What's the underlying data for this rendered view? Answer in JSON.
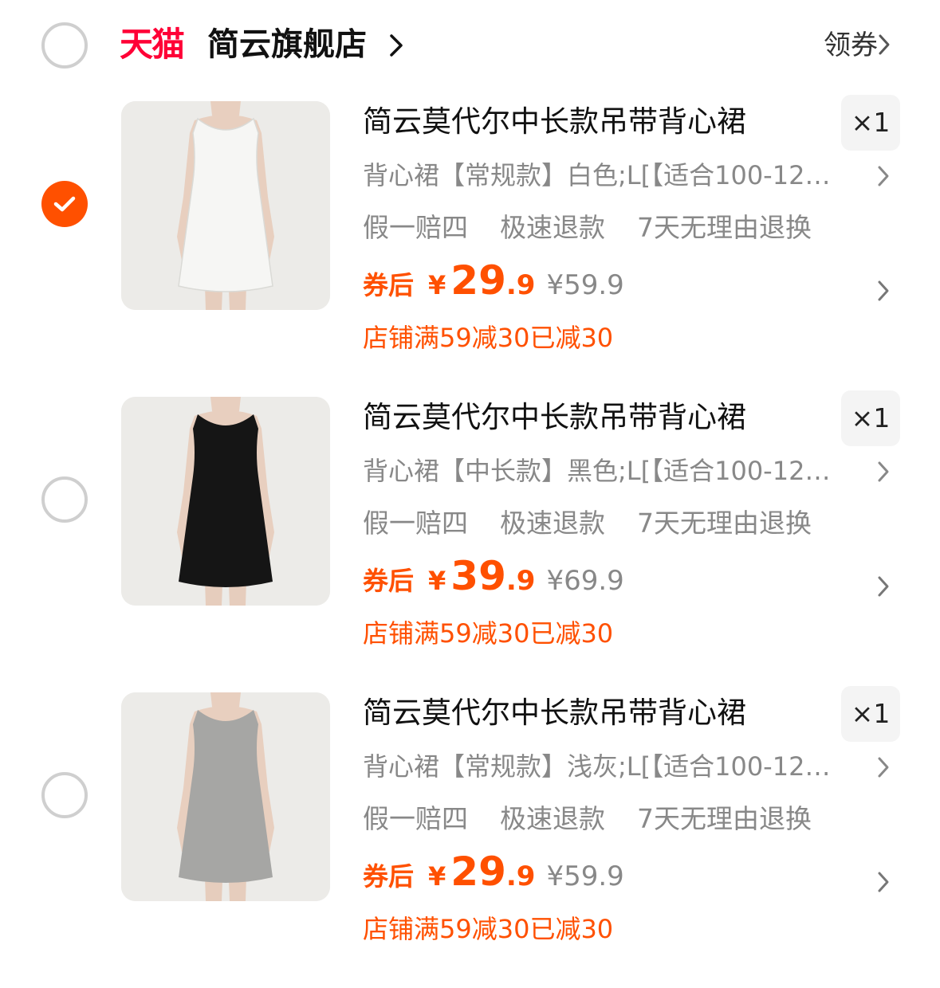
{
  "shop": {
    "platform": "天猫",
    "name": "简云旗舰店",
    "coupon_label": "领券"
  },
  "items": [
    {
      "title": "简云莫代尔中长款吊带背心裙",
      "quantity": "×1",
      "sku": "背心裙【常规款】白色;L[【适合100-12…",
      "services": [
        "假一赔四",
        "极速退款",
        "7天无理由退换"
      ],
      "after_coupon_label": "券后",
      "currency": "¥",
      "price_int": "29",
      "price_dec": ".9",
      "original_price": "¥59.9",
      "promo": "店铺满59减30已减30",
      "selected": true,
      "dress_color": "#f6f6f4"
    },
    {
      "title": "简云莫代尔中长款吊带背心裙",
      "quantity": "×1",
      "sku": "背心裙【中长款】黑色;L[【适合100-12…",
      "services": [
        "假一赔四",
        "极速退款",
        "7天无理由退换"
      ],
      "after_coupon_label": "券后",
      "currency": "¥",
      "price_int": "39",
      "price_dec": ".9",
      "original_price": "¥69.9",
      "promo": "店铺满59减30已减30",
      "selected": false,
      "dress_color": "#151515"
    },
    {
      "title": "简云莫代尔中长款吊带背心裙",
      "quantity": "×1",
      "sku": "背心裙【常规款】浅灰;L[【适合100-12…",
      "services": [
        "假一赔四",
        "极速退款",
        "7天无理由退换"
      ],
      "after_coupon_label": "券后",
      "currency": "¥",
      "price_int": "29",
      "price_dec": ".9",
      "original_price": "¥59.9",
      "promo": "店铺满59减30已减30",
      "selected": false,
      "dress_color": "#a6a6a4"
    }
  ],
  "colors": {
    "accent": "#ff5000",
    "tmall_red": "#ff0036",
    "muted_text": "#888888"
  }
}
